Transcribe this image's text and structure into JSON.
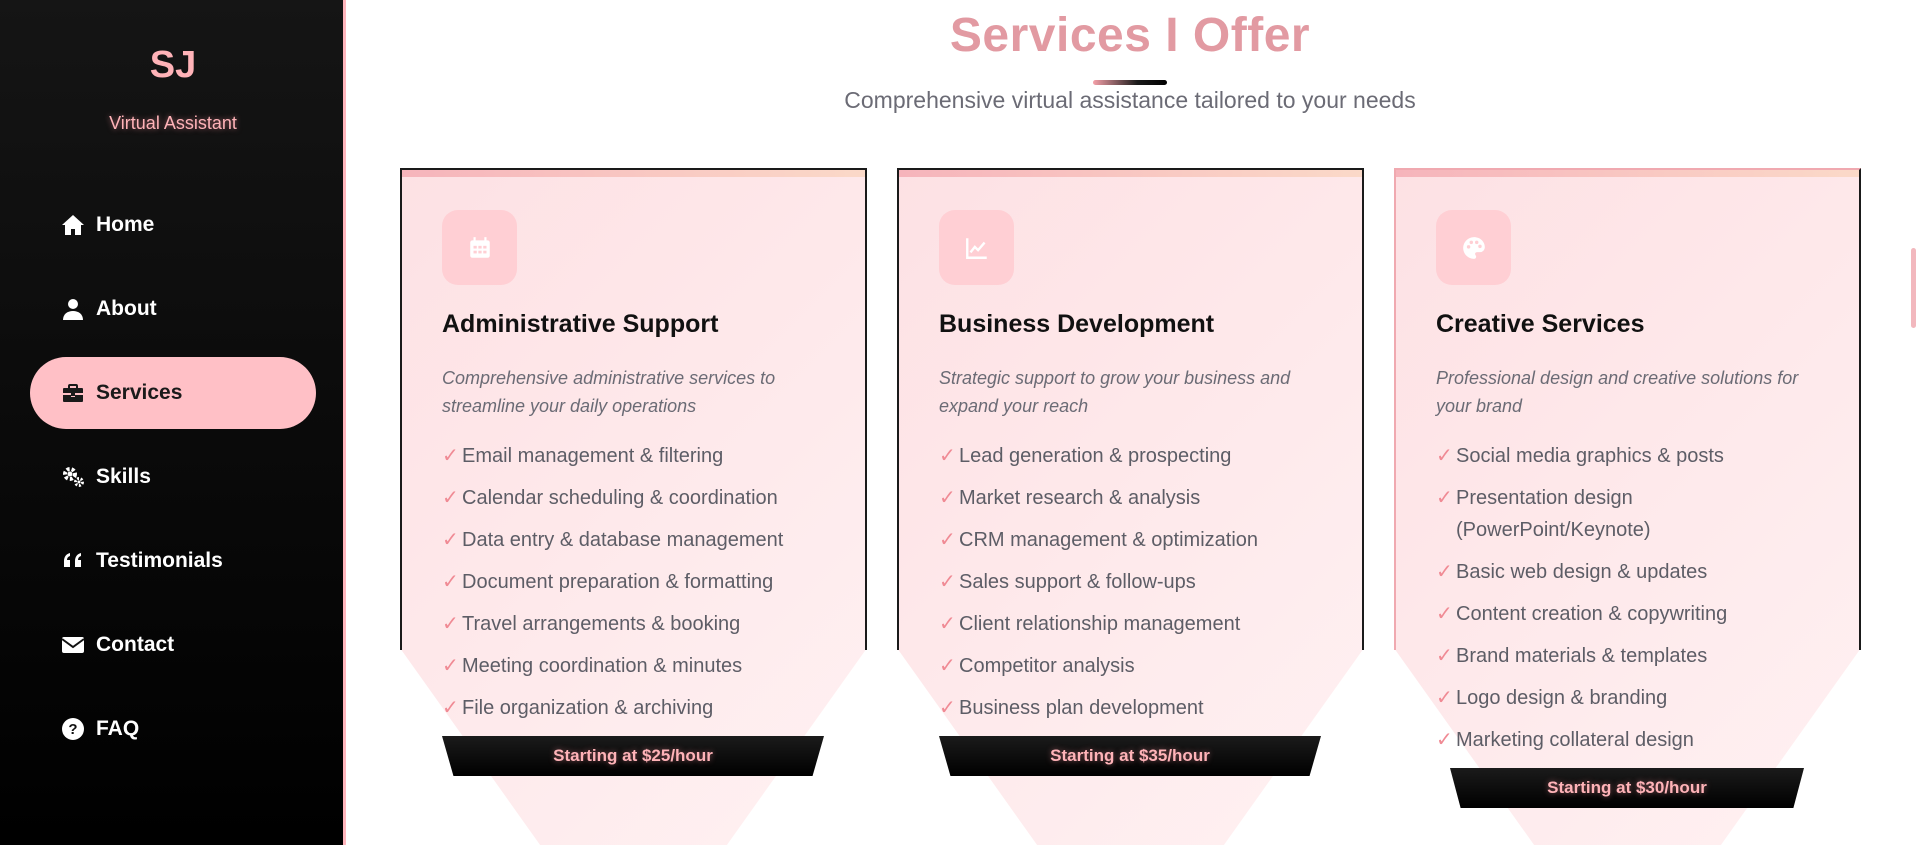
{
  "brand": {
    "initials": "SJ",
    "subtitle": "Virtual Assistant"
  },
  "nav": [
    {
      "label": "Home",
      "icon": "home-icon",
      "active": false
    },
    {
      "label": "About",
      "icon": "user-icon",
      "active": false
    },
    {
      "label": "Services",
      "icon": "briefcase-icon",
      "active": true
    },
    {
      "label": "Skills",
      "icon": "gears-icon",
      "active": false
    },
    {
      "label": "Testimonials",
      "icon": "quote-icon",
      "active": false
    },
    {
      "label": "Contact",
      "icon": "envelope-icon",
      "active": false
    },
    {
      "label": "FAQ",
      "icon": "question-circle-icon",
      "active": false
    }
  ],
  "section": {
    "title": "Services I Offer",
    "subtitle": "Comprehensive virtual assistance tailored to your needs"
  },
  "cards": [
    {
      "icon": "calendar-icon",
      "title": "Administrative Support",
      "description": "Comprehensive administrative services to streamline your daily operations",
      "features": [
        "Email management & filtering",
        "Calendar scheduling & coordination",
        "Data entry & database management",
        "Document preparation & formatting",
        "Travel arrangements & booking",
        "Meeting coordination & minutes",
        "File organization & archiving"
      ],
      "price": "Starting at $25/hour"
    },
    {
      "icon": "chart-line-icon",
      "title": "Business Development",
      "description": "Strategic support to grow your business and expand your reach",
      "features": [
        "Lead generation & prospecting",
        "Market research & analysis",
        "CRM management & optimization",
        "Sales support & follow-ups",
        "Client relationship management",
        "Competitor analysis",
        "Business plan development"
      ],
      "price": "Starting at $35/hour"
    },
    {
      "icon": "palette-icon",
      "title": "Creative Services",
      "description": "Professional design and creative solutions for your brand",
      "features": [
        "Social media graphics & posts",
        "Presentation design (PowerPoint/Keynote)",
        "Basic web design & updates",
        "Content creation & copywriting",
        "Brand materials & templates",
        "Logo design & branding",
        "Marketing collateral design"
      ],
      "price": "Starting at $30/hour"
    }
  ],
  "check_mark": "✓",
  "colors": {
    "accent_pink": "#ffc0c6",
    "title_pink": "#e29aa2",
    "sidebar_bg": "#000000",
    "check_color": "#f08a94"
  }
}
